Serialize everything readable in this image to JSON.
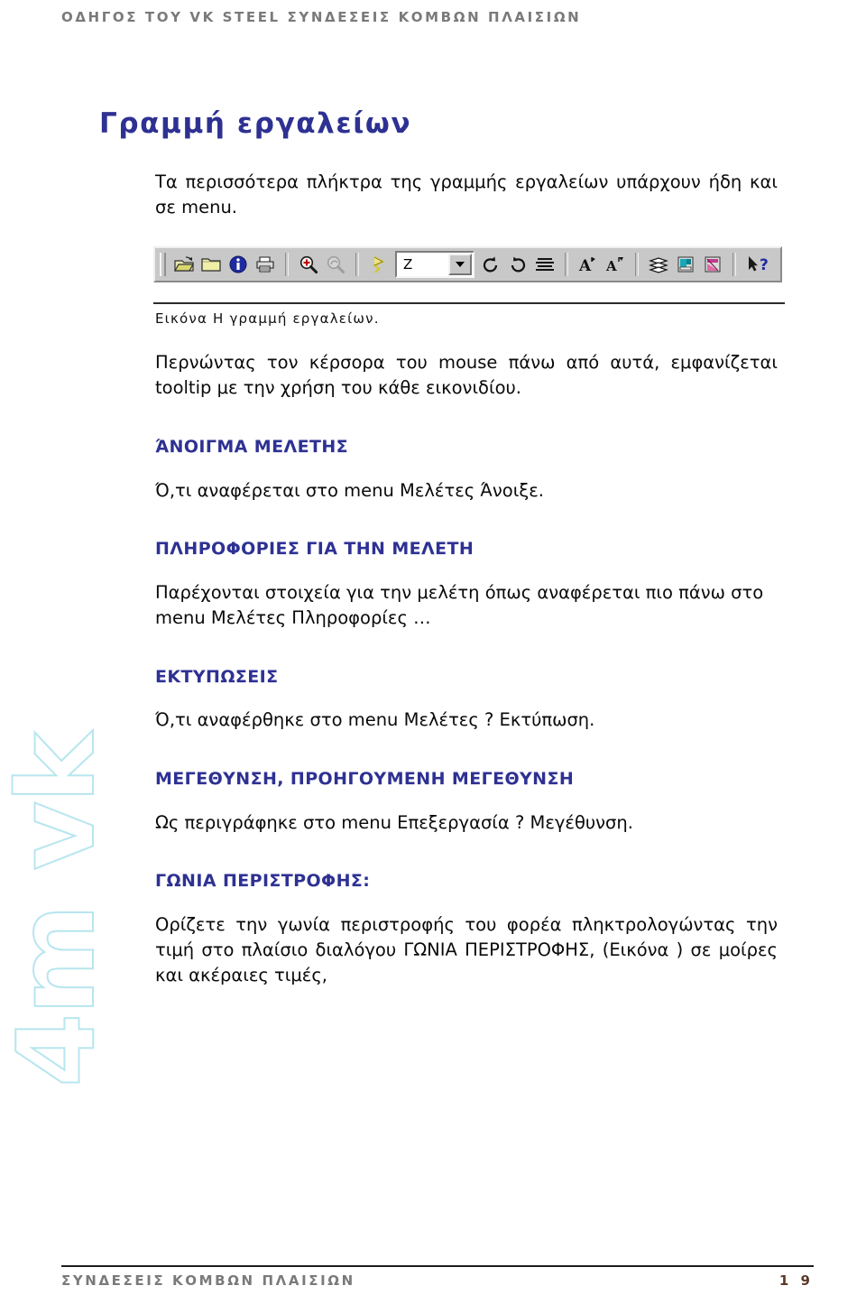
{
  "header": {
    "title": "ΟΔΗΓΟΣ ΤΟΥ VK STEEL ΣΥΝΔΕΣΕΙΣ ΚΟΜΒΩΝ ΠΛΑΙΣΙΩΝ"
  },
  "document": {
    "title": "Γραμμή εργαλείων",
    "intro": "Τα περισσότερα πλήκτρα της γραμμής εργαλείων υπάρχουν ήδη και σε menu.",
    "figure_caption": "Εικόνα Η γραμμή εργαλείων.",
    "after_figure": "Περνώντας τον κέρσορα του mouse πάνω από αυτά, εμφανίζεται tooltip με την χρήση του κάθε εικονιδίου."
  },
  "toolbar": {
    "combo_value": "Z",
    "groups": [
      {
        "buttons": [
          {
            "name": "open-study-icon",
            "label": "Άνοιγμα μελέτης"
          },
          {
            "name": "folder-icon",
            "label": "Φάκελος"
          },
          {
            "name": "info-icon",
            "label": "Πληροφορίες"
          },
          {
            "name": "print-icon",
            "label": "Εκτύπωση"
          }
        ]
      },
      {
        "buttons": [
          {
            "name": "zoom-in-icon",
            "label": "Μεγέθυνση"
          },
          {
            "name": "zoom-previous-icon",
            "label": "Προηγούμενη μεγέθυνση"
          }
        ]
      },
      {
        "buttons": [
          {
            "name": "rotation-angle-icon",
            "label": "Γωνία περιστροφής"
          }
        ]
      },
      {
        "buttons": [
          {
            "name": "rotate-left-icon",
            "label": "Περιστροφή αριστερά"
          },
          {
            "name": "rotate-right-icon",
            "label": "Περιστροφή δεξιά"
          },
          {
            "name": "list-lines-icon",
            "label": "Γραμμές"
          }
        ]
      },
      {
        "buttons": [
          {
            "name": "text-increase-icon",
            "label": "Αύξηση κειμένου"
          },
          {
            "name": "text-decrease-icon",
            "label": "Μείωση κειμένου"
          }
        ]
      },
      {
        "buttons": [
          {
            "name": "layers-icon",
            "label": "Επίπεδα"
          },
          {
            "name": "section-cyan-icon",
            "label": "Τομή"
          },
          {
            "name": "section-magenta-icon",
            "label": "Τομή 2"
          }
        ]
      },
      {
        "buttons": [
          {
            "name": "help-pointer-icon",
            "label": "Βοήθεια"
          }
        ]
      }
    ]
  },
  "sections": [
    {
      "heading": "ΆΝΟΙΓΜΑ ΜΕΛΕΤΗΣ",
      "text": "Ό,τι αναφέρεται στο menu Μελέτες Άνοιξε."
    },
    {
      "heading": "ΠΛΗΡΟΦΟΡΙΕΣ ΓΙΑ ΤΗΝ ΜΕΛΕΤΗ",
      "text": "Παρέχονται στοιχεία για την μελέτη όπως αναφέρεται πιο πάνω στο menu Μελέτες  Πληροφορίες …"
    },
    {
      "heading": "ΕΚΤΥΠΩΣΕΙΣ",
      "text": "Ό,τι αναφέρθηκε στο menu Μελέτες ? Εκτύπωση."
    },
    {
      "heading": "ΜΕΓΕΘΥΝΣΗ, ΠΡΟΗΓΟΥΜΕΝΗ ΜΕΓΕΘΥΝΣΗ",
      "text": "Ως περιγράφηκε στο menu Επεξεργασία ? Μεγέθυνση."
    },
    {
      "heading": "ΓΩΝΙΑ ΠΕΡΙΣΤΡΟΦΗΣ:",
      "text": "Ορίζετε την γωνία περιστροφής του φορέα πληκτρολογώντας την τιμή στο πλαίσιο διαλόγου ΓΩΝΙΑ ΠΕΡΙΣΤΡΟΦΗΣ, (Εικόνα   ) σε μοίρες και ακέραιες τιμές,"
    }
  ],
  "watermark": {
    "text": "4m vk",
    "color": "#b8e6ef"
  },
  "footer": {
    "title": "ΣΥΝΔΕΣΕΙΣ ΚΟΜΒΩΝ ΠΛΑΙΣΙΩΝ",
    "page_number": "1 9"
  },
  "colors": {
    "heading_navy": "#2e3192",
    "header_gray": "#7a7a7a",
    "page_number": "#5a3a28",
    "toolbar_face": "#c8c8c8"
  }
}
